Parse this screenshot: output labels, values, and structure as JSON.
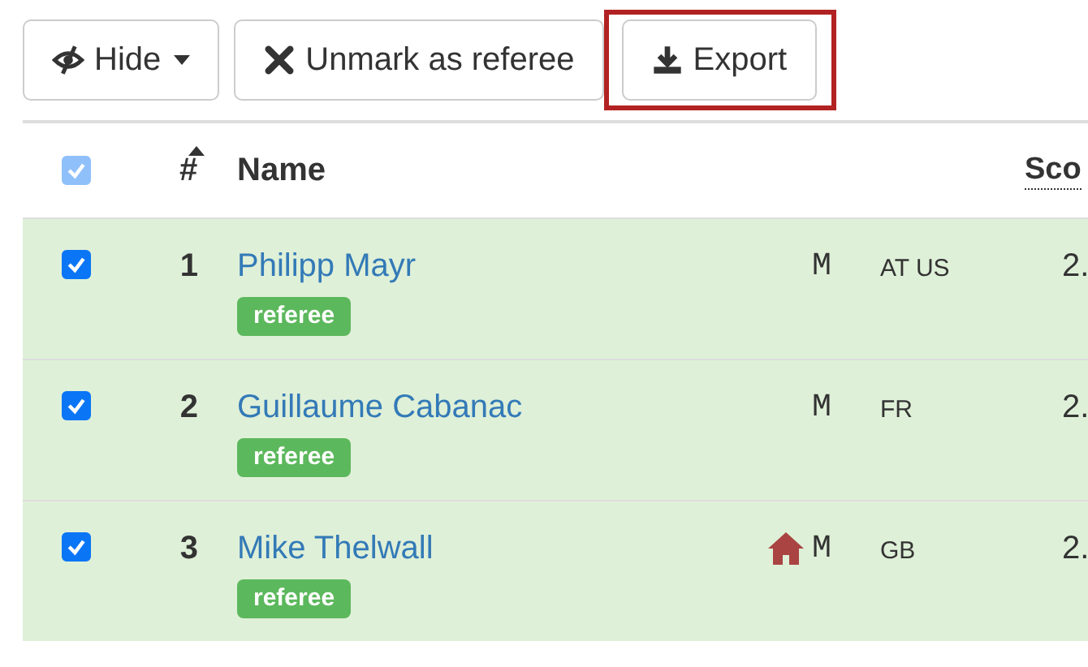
{
  "toolbar": {
    "buttons": [
      {
        "kind": "dropdown",
        "label": "Hide",
        "highlighted": false
      },
      {
        "kind": "plain",
        "label": "Unmark as referee",
        "highlighted": false
      },
      {
        "kind": "plain",
        "label": "Export",
        "highlighted": true
      }
    ]
  },
  "table": {
    "header": {
      "select_all": {
        "checked": true,
        "disabled": true
      },
      "columns": [
        {
          "label": "#",
          "sorted": true
        },
        {
          "label": "Name",
          "sorted": false
        },
        {
          "label": "Sco",
          "sorted": false
        }
      ]
    },
    "rows": [
      {
        "checked": true,
        "number": "1",
        "name": "Philipp Mayr",
        "badge": "referee",
        "home": false,
        "gender": "M",
        "countries": "AT US",
        "score": "2."
      },
      {
        "checked": true,
        "number": "2",
        "name": "Guillaume Cabanac",
        "badge": "referee",
        "home": false,
        "gender": "M",
        "countries": "FR",
        "score": "2."
      },
      {
        "checked": true,
        "number": "3",
        "name": "Mike Thelwall",
        "badge": "referee",
        "home": true,
        "gender": "M",
        "countries": "GB",
        "score": "2."
      }
    ]
  }
}
